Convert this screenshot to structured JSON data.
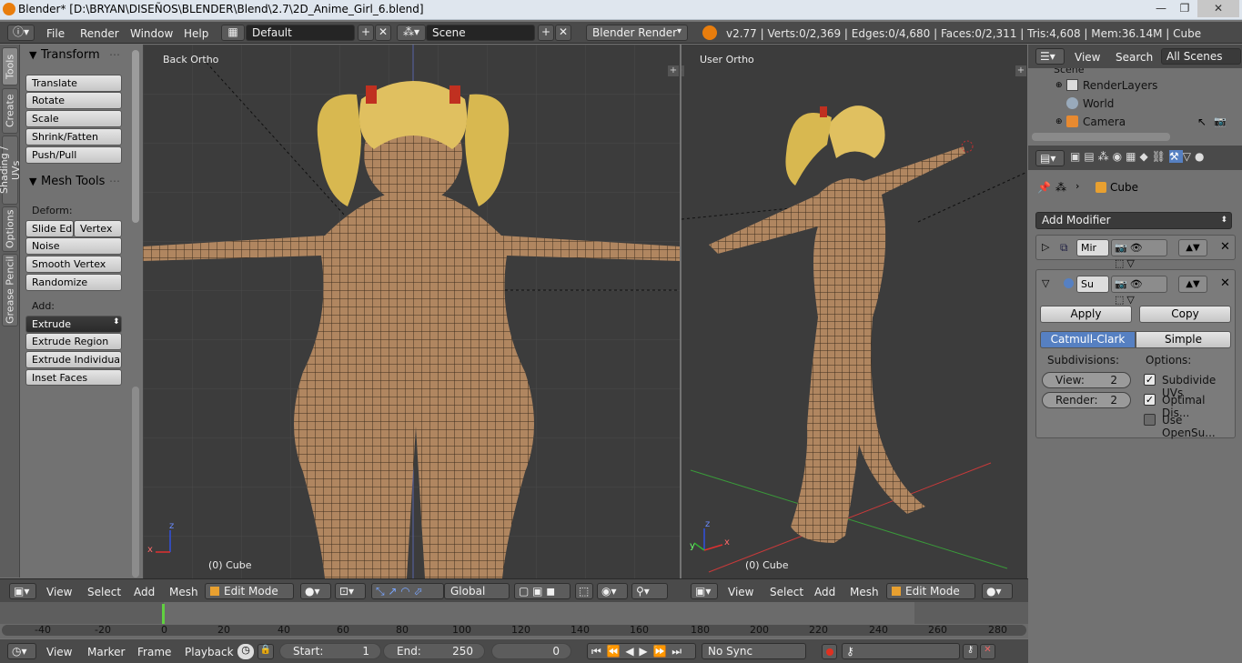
{
  "window": {
    "title": "Blender* [D:\\BRYAN\\DISEÑOS\\BLENDER\\Blend\\2.7\\2D_Anime_Girl_6.blend]",
    "minimize": "—",
    "maximize": "❐",
    "close": "✕"
  },
  "topbar": {
    "menus": [
      "File",
      "Render",
      "Window",
      "Help"
    ],
    "layout": "Default",
    "scene": "Scene",
    "engine": "Blender Render",
    "stats": "v2.77 | Verts:0/2,369 | Edges:0/4,680 | Faces:0/2,311 | Tris:4,608 | Mem:36.14M | Cube"
  },
  "toolshelf": {
    "tabs": [
      "Tools",
      "Create",
      "Shading / UVs",
      "Options",
      "Grease Pencil"
    ],
    "transform_title": "Transform",
    "transform_buttons": [
      "Translate",
      "Rotate",
      "Scale",
      "Shrink/Fatten",
      "Push/Pull"
    ],
    "mesh_tools_title": "Mesh Tools",
    "deform_label": "Deform:",
    "slide_edge": "Slide Ed",
    "vertex": "Vertex",
    "deform_buttons": [
      "Noise",
      "Smooth Vertex",
      "Randomize"
    ],
    "add_label": "Add:",
    "extrude": "Extrude",
    "add_buttons": [
      "Extrude Region",
      "Extrude Individual",
      "Inset Faces"
    ]
  },
  "viewport_left": {
    "label": "Back Ortho",
    "object": "(0) Cube",
    "axis_x": "x",
    "axis_z": "z"
  },
  "viewport_right": {
    "label": "User Ortho",
    "object": "(0) Cube",
    "axis_x": "x",
    "axis_y": "y",
    "axis_z": "z"
  },
  "viewport_header": {
    "menus": [
      "View",
      "Select",
      "Add",
      "Mesh"
    ],
    "mode": "Edit Mode",
    "orientation": "Global"
  },
  "timeline": {
    "ticks": [
      "-40",
      "-20",
      "0",
      "20",
      "40",
      "60",
      "80",
      "100",
      "120",
      "140",
      "160",
      "180",
      "200",
      "220",
      "240",
      "260",
      "280"
    ],
    "menus": [
      "View",
      "Marker",
      "Frame",
      "Playback"
    ],
    "start_label": "Start:",
    "start_value": "1",
    "end_label": "End:",
    "end_value": "250",
    "current_frame": "0",
    "sync": "No Sync"
  },
  "outliner": {
    "view": "View",
    "search": "Search",
    "scenes": "All Scenes",
    "items": [
      "Scene",
      "RenderLayers",
      "World",
      "Camera"
    ]
  },
  "properties": {
    "object": "Cube",
    "add_modifier": "Add Modifier",
    "mod1_name": "Mir",
    "mod2_name": "Su",
    "apply": "Apply",
    "copy": "Copy",
    "catmull": "Catmull-Clark",
    "simple": "Simple",
    "subdivisions": "Subdivisions:",
    "options": "Options:",
    "view_label": "View:",
    "view_value": "2",
    "render_label": "Render:",
    "render_value": "2",
    "opt1": "Subdivide UVs",
    "opt2": "Optimal Dis...",
    "opt3": "Use OpenSu..."
  },
  "colors": {
    "accent": "#5680c2",
    "viewport_bg": "#3c3c3c",
    "panel": "#727272",
    "mesh": "#b08660",
    "hair": "#e0c060"
  }
}
